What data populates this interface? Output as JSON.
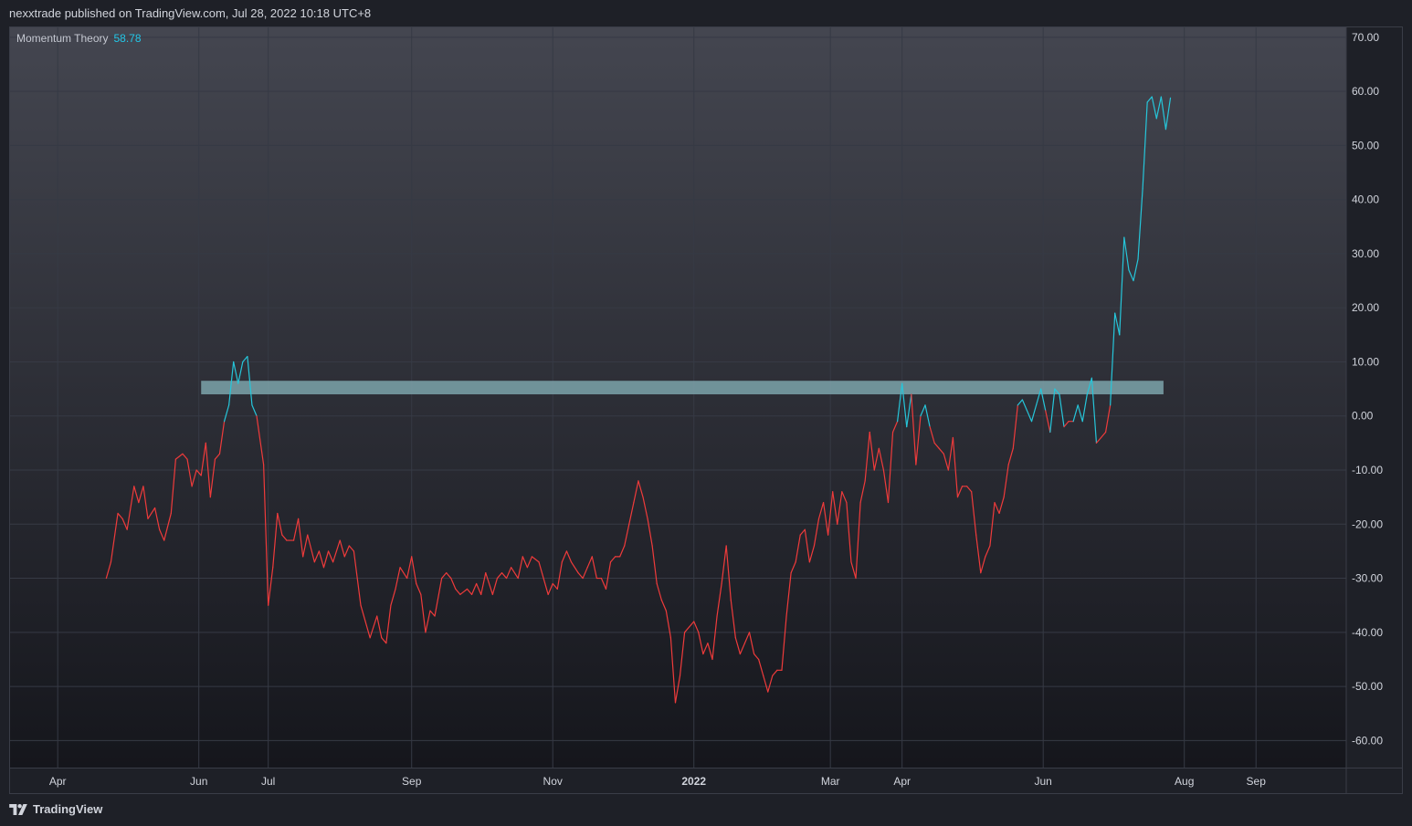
{
  "header": {
    "published": "nexxtrade published on TradingView.com, Jul 28, 2022 10:18 UTC+8"
  },
  "footer": {
    "brand": "TradingView"
  },
  "legend": {
    "name": "Momentum Theory",
    "value": "58.78"
  },
  "colors": {
    "bull": "#26c6da",
    "bear": "#ef3b3b",
    "band": "#7da3aa",
    "grid": "#363a45",
    "text": "#d1d4dc"
  },
  "chart_data": {
    "type": "line",
    "ylim": [
      -65,
      72
    ],
    "y_ticks": [
      "70.00",
      "60.00",
      "50.00",
      "40.00",
      "30.00",
      "20.00",
      "10.00",
      "0.00",
      "-10.00",
      "-20.00",
      "-30.00",
      "-40.00",
      "-50.00",
      "-60.00"
    ],
    "x_range": [
      "2021-03-11",
      "2022-10-10"
    ],
    "x_ticks": [
      {
        "date": "2021-04-01",
        "label": "Apr"
      },
      {
        "date": "2021-06-01",
        "label": "Jun"
      },
      {
        "date": "2021-07-01",
        "label": "Jul"
      },
      {
        "date": "2021-09-01",
        "label": "Sep"
      },
      {
        "date": "2021-11-01",
        "label": "Nov"
      },
      {
        "date": "2022-01-01",
        "label": "2022"
      },
      {
        "date": "2022-03-01",
        "label": "Mar"
      },
      {
        "date": "2022-04-01",
        "label": "Apr"
      },
      {
        "date": "2022-06-01",
        "label": "Jun"
      },
      {
        "date": "2022-08-01",
        "label": "Aug"
      },
      {
        "date": "2022-09-01",
        "label": "Sep"
      }
    ],
    "band": {
      "y_low": 4,
      "y_high": 6.5,
      "x_start": "2021-06-02",
      "x_end": "2022-07-23"
    },
    "series": [
      {
        "points": [
          [
            "2021-04-22",
            -30
          ],
          [
            "2021-04-24",
            -27
          ],
          [
            "2021-04-27",
            -18
          ],
          [
            "2021-04-29",
            -19
          ],
          [
            "2021-05-01",
            -21
          ],
          [
            "2021-05-04",
            -13
          ],
          [
            "2021-05-06",
            -16
          ],
          [
            "2021-05-08",
            -13
          ],
          [
            "2021-05-10",
            -19
          ],
          [
            "2021-05-13",
            -17
          ],
          [
            "2021-05-15",
            -21
          ],
          [
            "2021-05-17",
            -23
          ],
          [
            "2021-05-20",
            -18
          ],
          [
            "2021-05-22",
            -8
          ],
          [
            "2021-05-25",
            -7
          ],
          [
            "2021-05-27",
            -8
          ],
          [
            "2021-05-29",
            -13
          ],
          [
            "2021-05-31",
            -10
          ],
          [
            "2021-06-02",
            -11
          ],
          [
            "2021-06-04",
            -5
          ],
          [
            "2021-06-06",
            -15
          ],
          [
            "2021-06-08",
            -8
          ],
          [
            "2021-06-10",
            -7
          ],
          [
            "2021-06-12",
            -1
          ],
          [
            "2021-06-14",
            2
          ],
          [
            "2021-06-16",
            10
          ],
          [
            "2021-06-18",
            6
          ],
          [
            "2021-06-20",
            10
          ],
          [
            "2021-06-22",
            11
          ],
          [
            "2021-06-24",
            2
          ],
          [
            "2021-06-26",
            0
          ],
          [
            "2021-06-29",
            -9
          ],
          [
            "2021-07-01",
            -35
          ],
          [
            "2021-07-03",
            -28
          ],
          [
            "2021-07-05",
            -18
          ],
          [
            "2021-07-07",
            -22
          ],
          [
            "2021-07-09",
            -23
          ],
          [
            "2021-07-12",
            -23
          ],
          [
            "2021-07-14",
            -19
          ],
          [
            "2021-07-16",
            -26
          ],
          [
            "2021-07-18",
            -22
          ],
          [
            "2021-07-21",
            -27
          ],
          [
            "2021-07-23",
            -25
          ],
          [
            "2021-07-25",
            -28
          ],
          [
            "2021-07-27",
            -25
          ],
          [
            "2021-07-29",
            -27
          ],
          [
            "2021-08-01",
            -23
          ],
          [
            "2021-08-03",
            -26
          ],
          [
            "2021-08-05",
            -24
          ],
          [
            "2021-08-07",
            -25
          ],
          [
            "2021-08-10",
            -35
          ],
          [
            "2021-08-12",
            -38
          ],
          [
            "2021-08-14",
            -41
          ],
          [
            "2021-08-17",
            -37
          ],
          [
            "2021-08-19",
            -41
          ],
          [
            "2021-08-21",
            -42
          ],
          [
            "2021-08-23",
            -35
          ],
          [
            "2021-08-25",
            -32
          ],
          [
            "2021-08-27",
            -28
          ],
          [
            "2021-08-30",
            -30
          ],
          [
            "2021-09-01",
            -26
          ],
          [
            "2021-09-03",
            -31
          ],
          [
            "2021-09-05",
            -33
          ],
          [
            "2021-09-07",
            -40
          ],
          [
            "2021-09-09",
            -36
          ],
          [
            "2021-09-11",
            -37
          ],
          [
            "2021-09-14",
            -30
          ],
          [
            "2021-09-16",
            -29
          ],
          [
            "2021-09-18",
            -30
          ],
          [
            "2021-09-20",
            -32
          ],
          [
            "2021-09-22",
            -33
          ],
          [
            "2021-09-25",
            -32
          ],
          [
            "2021-09-27",
            -33
          ],
          [
            "2021-09-29",
            -31
          ],
          [
            "2021-10-01",
            -33
          ],
          [
            "2021-10-03",
            -29
          ],
          [
            "2021-10-06",
            -33
          ],
          [
            "2021-10-08",
            -30
          ],
          [
            "2021-10-10",
            -29
          ],
          [
            "2021-10-12",
            -30
          ],
          [
            "2021-10-14",
            -28
          ],
          [
            "2021-10-17",
            -30
          ],
          [
            "2021-10-19",
            -26
          ],
          [
            "2021-10-21",
            -28
          ],
          [
            "2021-10-23",
            -26
          ],
          [
            "2021-10-26",
            -27
          ],
          [
            "2021-10-28",
            -30
          ],
          [
            "2021-10-30",
            -33
          ],
          [
            "2021-11-01",
            -31
          ],
          [
            "2021-11-03",
            -32
          ],
          [
            "2021-11-05",
            -27
          ],
          [
            "2021-11-07",
            -25
          ],
          [
            "2021-11-09",
            -27
          ],
          [
            "2021-11-12",
            -29
          ],
          [
            "2021-11-14",
            -30
          ],
          [
            "2021-11-16",
            -28
          ],
          [
            "2021-11-18",
            -26
          ],
          [
            "2021-11-20",
            -30
          ],
          [
            "2021-11-22",
            -30
          ],
          [
            "2021-11-24",
            -32
          ],
          [
            "2021-11-26",
            -27
          ],
          [
            "2021-11-28",
            -26
          ],
          [
            "2021-11-30",
            -26
          ],
          [
            "2021-12-02",
            -24
          ],
          [
            "2021-12-04",
            -20
          ],
          [
            "2021-12-06",
            -16
          ],
          [
            "2021-12-08",
            -12
          ],
          [
            "2021-12-10",
            -15
          ],
          [
            "2021-12-12",
            -19
          ],
          [
            "2021-12-14",
            -24
          ],
          [
            "2021-12-16",
            -31
          ],
          [
            "2021-12-18",
            -34
          ],
          [
            "2021-12-20",
            -36
          ],
          [
            "2021-12-22",
            -41
          ],
          [
            "2021-12-24",
            -53
          ],
          [
            "2021-12-26",
            -48
          ],
          [
            "2021-12-28",
            -40
          ],
          [
            "2021-12-30",
            -39
          ],
          [
            "2022-01-01",
            -38
          ],
          [
            "2022-01-03",
            -40
          ],
          [
            "2022-01-05",
            -44
          ],
          [
            "2022-01-07",
            -42
          ],
          [
            "2022-01-09",
            -45
          ],
          [
            "2022-01-11",
            -37
          ],
          [
            "2022-01-13",
            -31
          ],
          [
            "2022-01-15",
            -24
          ],
          [
            "2022-01-17",
            -34
          ],
          [
            "2022-01-19",
            -41
          ],
          [
            "2022-01-21",
            -44
          ],
          [
            "2022-01-23",
            -42
          ],
          [
            "2022-01-25",
            -40
          ],
          [
            "2022-01-27",
            -44
          ],
          [
            "2022-01-29",
            -45
          ],
          [
            "2022-01-31",
            -48
          ],
          [
            "2022-02-02",
            -51
          ],
          [
            "2022-02-04",
            -48
          ],
          [
            "2022-02-06",
            -47
          ],
          [
            "2022-02-08",
            -47
          ],
          [
            "2022-02-10",
            -37
          ],
          [
            "2022-02-12",
            -29
          ],
          [
            "2022-02-14",
            -27
          ],
          [
            "2022-02-16",
            -22
          ],
          [
            "2022-02-18",
            -21
          ],
          [
            "2022-02-20",
            -27
          ],
          [
            "2022-02-22",
            -24
          ],
          [
            "2022-02-24",
            -19
          ],
          [
            "2022-02-26",
            -16
          ],
          [
            "2022-02-28",
            -22
          ],
          [
            "2022-03-02",
            -14
          ],
          [
            "2022-03-04",
            -20
          ],
          [
            "2022-03-06",
            -14
          ],
          [
            "2022-03-08",
            -16
          ],
          [
            "2022-03-10",
            -27
          ],
          [
            "2022-03-12",
            -30
          ],
          [
            "2022-03-14",
            -16
          ],
          [
            "2022-03-16",
            -12
          ],
          [
            "2022-03-18",
            -3
          ],
          [
            "2022-03-20",
            -10
          ],
          [
            "2022-03-22",
            -6
          ],
          [
            "2022-03-24",
            -10
          ],
          [
            "2022-03-26",
            -16
          ],
          [
            "2022-03-28",
            -3
          ],
          [
            "2022-03-30",
            -1
          ],
          [
            "2022-04-01",
            6
          ],
          [
            "2022-04-03",
            -2
          ],
          [
            "2022-04-05",
            4
          ],
          [
            "2022-04-07",
            -9
          ],
          [
            "2022-04-09",
            0
          ],
          [
            "2022-04-11",
            2
          ],
          [
            "2022-04-13",
            -2
          ],
          [
            "2022-04-15",
            -5
          ],
          [
            "2022-04-17",
            -6
          ],
          [
            "2022-04-19",
            -7
          ],
          [
            "2022-04-21",
            -10
          ],
          [
            "2022-04-23",
            -4
          ],
          [
            "2022-04-25",
            -15
          ],
          [
            "2022-04-27",
            -13
          ],
          [
            "2022-04-29",
            -13
          ],
          [
            "2022-05-01",
            -14
          ],
          [
            "2022-05-03",
            -22
          ],
          [
            "2022-05-05",
            -29
          ],
          [
            "2022-05-07",
            -26
          ],
          [
            "2022-05-09",
            -24
          ],
          [
            "2022-05-11",
            -16
          ],
          [
            "2022-05-13",
            -18
          ],
          [
            "2022-05-15",
            -15
          ],
          [
            "2022-05-17",
            -9
          ],
          [
            "2022-05-19",
            -6
          ],
          [
            "2022-05-21",
            2
          ],
          [
            "2022-05-23",
            3
          ],
          [
            "2022-05-25",
            1
          ],
          [
            "2022-05-27",
            -1
          ],
          [
            "2022-05-29",
            2
          ],
          [
            "2022-05-31",
            5
          ],
          [
            "2022-06-02",
            1
          ],
          [
            "2022-06-04",
            -3
          ],
          [
            "2022-06-06",
            5
          ],
          [
            "2022-06-08",
            4
          ],
          [
            "2022-06-10",
            -2
          ],
          [
            "2022-06-12",
            -1
          ],
          [
            "2022-06-14",
            -1
          ],
          [
            "2022-06-16",
            2
          ],
          [
            "2022-06-18",
            -1
          ],
          [
            "2022-06-20",
            4
          ],
          [
            "2022-06-22",
            7
          ],
          [
            "2022-06-24",
            -5
          ],
          [
            "2022-06-26",
            -4
          ],
          [
            "2022-06-28",
            -3
          ],
          [
            "2022-06-30",
            2
          ],
          [
            "2022-07-02",
            19
          ],
          [
            "2022-07-04",
            15
          ],
          [
            "2022-07-06",
            33
          ],
          [
            "2022-07-08",
            27
          ],
          [
            "2022-07-10",
            25
          ],
          [
            "2022-07-12",
            29
          ],
          [
            "2022-07-14",
            42
          ],
          [
            "2022-07-16",
            58
          ],
          [
            "2022-07-18",
            59
          ],
          [
            "2022-07-20",
            55
          ],
          [
            "2022-07-22",
            59
          ],
          [
            "2022-07-24",
            53
          ],
          [
            "2022-07-26",
            58.78
          ]
        ]
      }
    ]
  }
}
